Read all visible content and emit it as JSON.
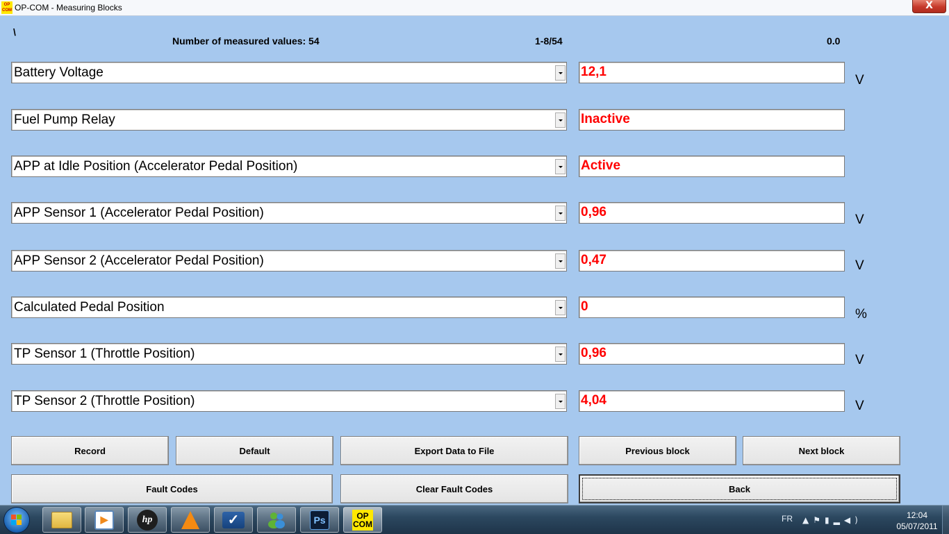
{
  "window": {
    "title": "OP-COM - Measuring Blocks",
    "app_icon_text": [
      "OP",
      "COM"
    ],
    "close_glyph": "X"
  },
  "header": {
    "prefix": "\\",
    "measured_values": "Number of measured values: 54",
    "range": "1-8/54",
    "value": "0.0"
  },
  "rows": [
    {
      "label": "Battery Voltage",
      "value": "12,1",
      "unit": "V"
    },
    {
      "label": "Fuel Pump Relay",
      "value": "Inactive",
      "unit": ""
    },
    {
      "label": "APP at Idle Position (Accelerator Pedal Position)",
      "value": "Active",
      "unit": ""
    },
    {
      "label": "APP Sensor 1 (Accelerator Pedal Position)",
      "value": "0,96",
      "unit": "V"
    },
    {
      "label": "APP Sensor 2 (Accelerator Pedal Position)",
      "value": "0,47",
      "unit": "V"
    },
    {
      "label": "Calculated Pedal Position",
      "value": "0",
      "unit": "%"
    },
    {
      "label": "TP Sensor 1 (Throttle Position)",
      "value": "0,96",
      "unit": "V"
    },
    {
      "label": "TP Sensor 2 (Throttle Position)",
      "value": "4,04",
      "unit": "V"
    }
  ],
  "buttons": {
    "record": "Record",
    "default": "Default",
    "export": "Export Data to File",
    "previous_block": "Previous block",
    "next_block": "Next block",
    "fault_codes": "Fault Codes",
    "clear_fault_codes": "Clear Fault Codes",
    "back": "Back"
  },
  "taskbar": {
    "icons": [
      "windows-explorer-icon",
      "windows-media-player-icon",
      "hp-icon",
      "vlc-icon",
      "check-app-icon",
      "messenger-icon",
      "photoshop-icon",
      "opcom-icon"
    ],
    "ps_label": "Ps",
    "hp_label": "hp",
    "opcom_label": [
      "OP",
      "COM"
    ],
    "language": "FR",
    "time": "12:04",
    "date": "05/07/2011"
  },
  "colors": {
    "background": "#a6c8ee",
    "value_text": "#ff0000"
  }
}
